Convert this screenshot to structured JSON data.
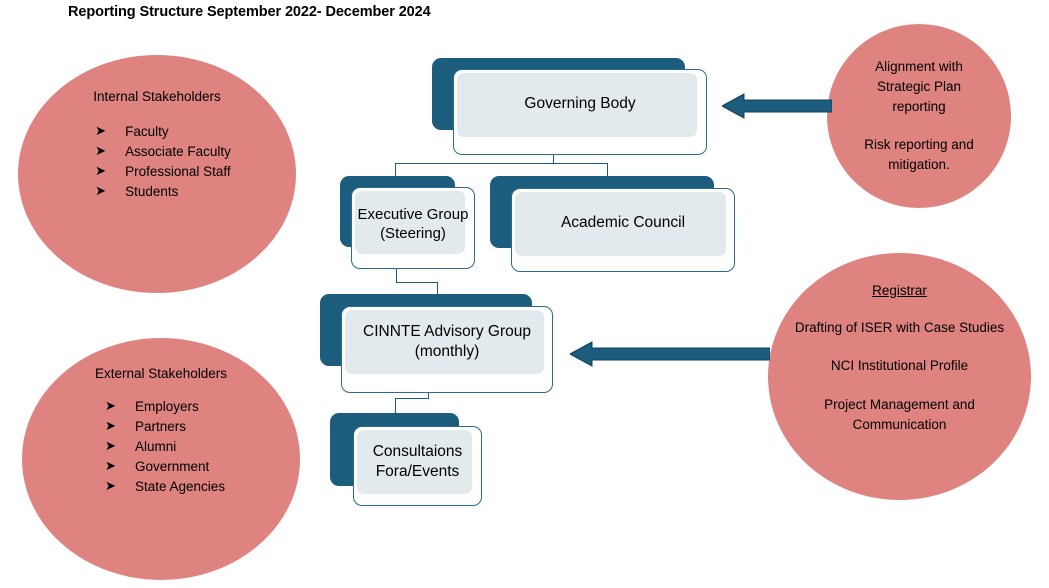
{
  "page": {
    "title": "Reporting Structure September 2022- December 2024"
  },
  "colors": {
    "circle_fill": "#DE8380",
    "box_shadow_teal": "#1C5C7D",
    "box_fill": "#E3EAEE",
    "box_outline": "#2A6A8A",
    "arrow": "#1C5C7D",
    "text": "#000000"
  },
  "circles": {
    "internal": {
      "title": "Internal Stakeholders",
      "bullet_glyph": "➤",
      "items": [
        "Faculty",
        "Associate Faculty",
        "Professional Staff",
        "Students"
      ]
    },
    "external": {
      "title": "External Stakeholders",
      "bullet_glyph": "➤",
      "items": [
        "Employers",
        "Partners",
        "Alumni",
        "Government",
        "State Agencies"
      ]
    },
    "alignment": {
      "paragraph_1": "Alignment with Strategic Plan reporting",
      "paragraph_2": "Risk reporting and mitigation."
    },
    "registrar": {
      "title": "Registrar",
      "paragraph_1": "Drafting of ISER with Case Studies",
      "paragraph_2": "NCI Institutional Profile",
      "paragraph_3": "Project Management and Communication"
    }
  },
  "boxes": {
    "governing_body": "Governing Body",
    "executive_group": "Executive Group\n(Steering)",
    "academic_council": "Academic Council",
    "cinnte_advisory": "CINNTE Advisory Group\n(monthly)",
    "consultations": "Consultaions Fora/Events"
  },
  "arrows": {
    "top_arrow_direction": "left",
    "bottom_arrow_direction": "left"
  }
}
